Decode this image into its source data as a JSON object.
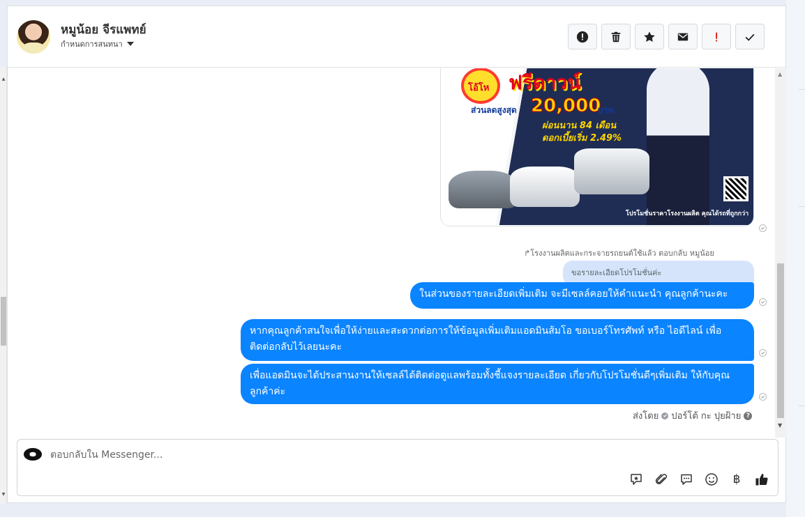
{
  "header": {
    "contact_name": "หมูน้อย จีรแพทย์",
    "status_label": "กำหนดการสนทนา",
    "actions": [
      {
        "name": "report-button",
        "icon": "exclamation-circle-icon"
      },
      {
        "name": "delete-button",
        "icon": "trash-icon"
      },
      {
        "name": "star-button",
        "icon": "star-icon"
      },
      {
        "name": "mark-unread-button",
        "icon": "envelope-icon"
      },
      {
        "name": "important-button",
        "icon": "exclamation-icon"
      },
      {
        "name": "done-button",
        "icon": "check-icon"
      }
    ]
  },
  "ad_image": {
    "badge": "โอ้โห",
    "headline": "ฟรีดาวน์",
    "discount_label": "ส่วนลดสูงสุด",
    "discount_amount": "20,000",
    "currency": "บาท",
    "installment": "ผ่อนนาน 84 เดือน",
    "interest": "ดอกเบี้ยเริ่ม 2.49%",
    "footer": "โปรโมชั่นราคาโรงงานผลิต คุณได้รถที่ถูกกว่า"
  },
  "conversation": {
    "reply_note": "โรงงานผลิตและกระจายรถยนต์ใช้แล้ว ตอบกลับ หมูน้อย",
    "quoted_message": "ขอรายละเอียดโปรโมชั่นค่ะ",
    "messages": [
      "ในส่วนของรายละเอียดเพิ่มเติม จะมีเซลล์คอยให้คำแนะนำ คุณลูกค้านะคะ",
      "หากคุณลูกค้าสนใจเพื่อให้ง่ายและสะดวกต่อการให้ข้อมูลเพิ่มเติมแอดมินส้มโอ ขอเบอร์โทรศัพท์ หรือ ไอดีไลน์ เพื่อติดต่อกลับไว้เลยนะคะ",
      "เพื่อแอดมินจะได้ประสานงานให้เซลล์ได้ติดต่อดูแลพร้อมทั้งชี้แจงรายละเอียด เกี่ยวกับโปรโมชั่นดีๆเพิ่มเติม ให้กับคุณลูกค้าค่ะ"
    ],
    "sent_by_label": "ส่งโดย",
    "sent_by_name": "ปอร์โต้ กะ ปุยฝ้าย"
  },
  "composer": {
    "placeholder": "ตอบกลับใน Messenger...",
    "tools": [
      "sticker-icon",
      "attachment-icon",
      "saved-reply-icon",
      "emoji-icon",
      "baht-icon",
      "like-icon"
    ],
    "baht_symbol": "฿"
  },
  "colors": {
    "bubble": "#0b84ff",
    "quoted": "#d6e4fb",
    "important": "#e0241b"
  }
}
